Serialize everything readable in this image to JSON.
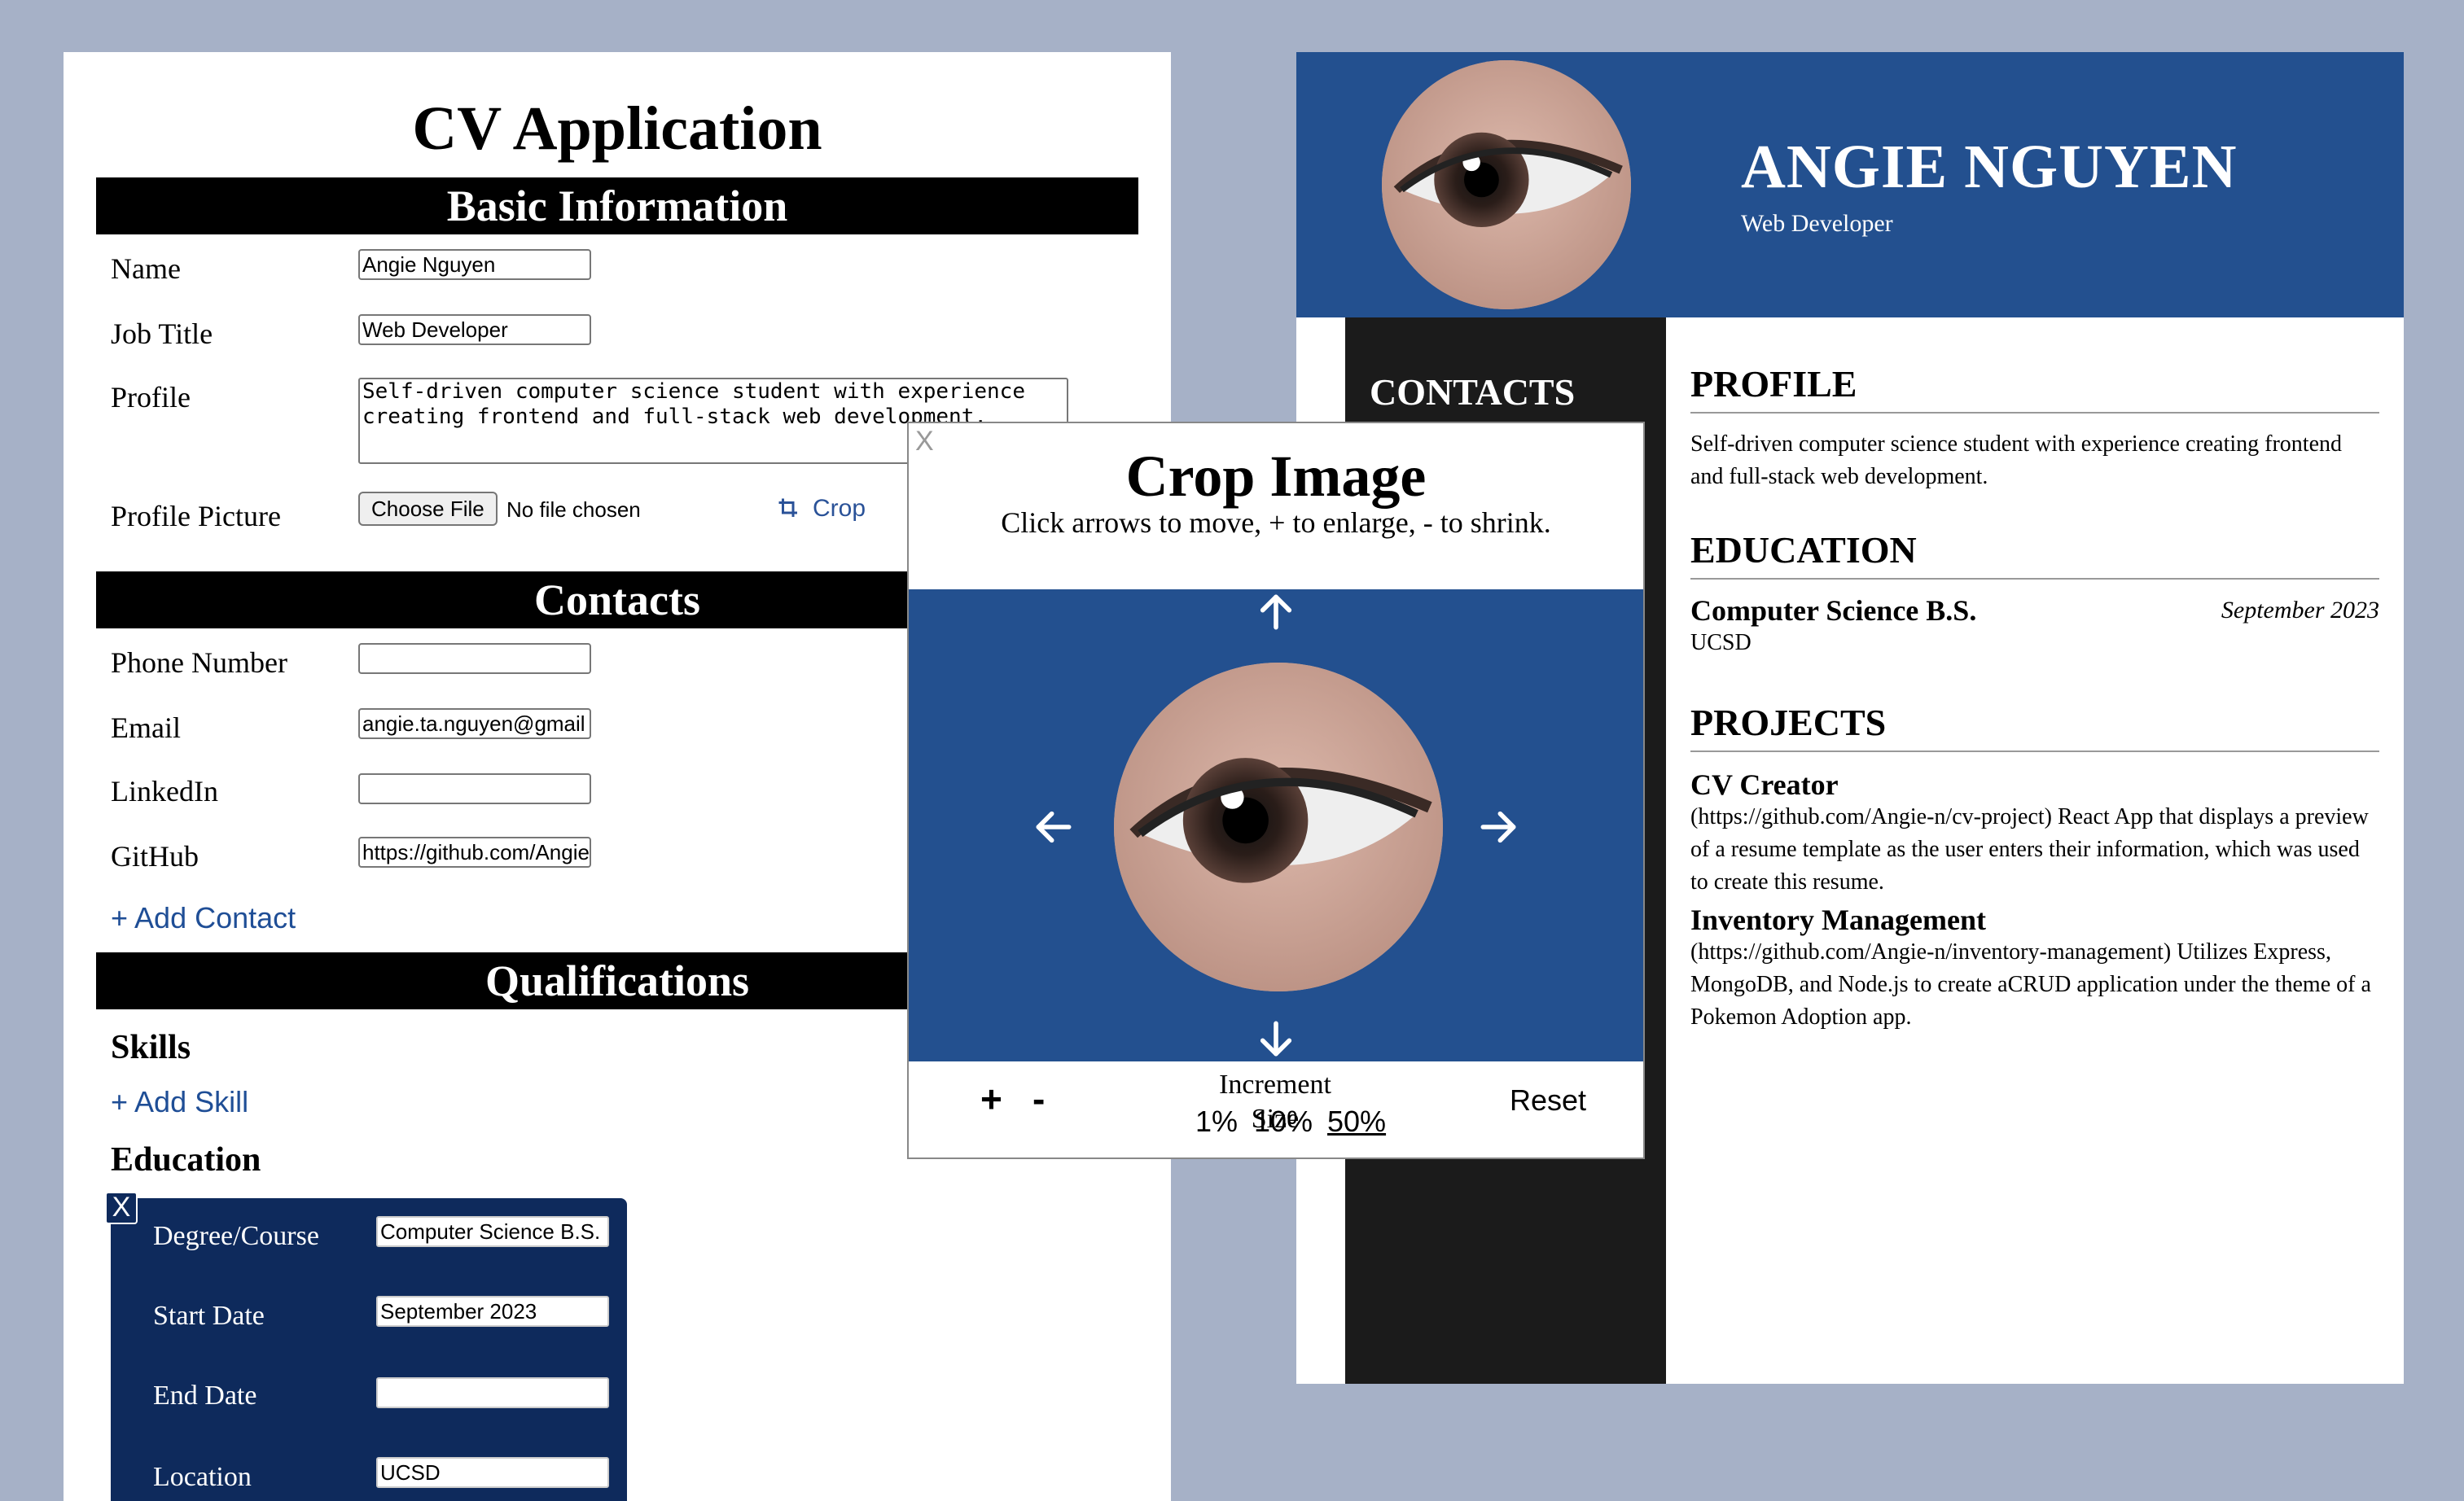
{
  "form": {
    "title": "CV Application",
    "sections": {
      "basic": "Basic Information",
      "contacts": "Contacts",
      "qualifications": "Qualifications"
    },
    "basic": {
      "name_label": "Name",
      "name_value": "Angie Nguyen",
      "job_label": "Job Title",
      "job_value": "Web Developer",
      "profile_label": "Profile",
      "profile_value": "Self-driven computer science student with experience creating frontend and full-stack web development.",
      "picture_label": "Profile Picture",
      "file_button": "Choose File",
      "file_status": "No file chosen",
      "crop_label": "Crop"
    },
    "contacts": {
      "phone_label": "Phone Number",
      "phone_value": "",
      "email_label": "Email",
      "email_value": "angie.ta.nguyen@gmail",
      "linkedin_label": "LinkedIn",
      "linkedin_value": "",
      "github_label": "GitHub",
      "github_value": "https://github.com/Angie",
      "add_contact": "+ Add Contact"
    },
    "qualifications": {
      "skills_heading": "Skills",
      "add_skill": "+ Add Skill",
      "education_heading": "Education",
      "education_entry": {
        "close": "X",
        "degree_label": "Degree/Course",
        "degree_value": "Computer Science B.S.",
        "start_label": "Start Date",
        "start_value": "September 2023",
        "end_label": "End Date",
        "end_value": "",
        "location_label": "Location",
        "location_value": "UCSD"
      }
    }
  },
  "resume": {
    "name": "ANGIE NGUYEN",
    "job_title": "Web Developer",
    "sidebar_heading": "CONTACTS",
    "profile_heading": "PROFILE",
    "profile_text": "Self-driven computer science student with experience creating frontend and full-stack web development.",
    "education_heading": "EDUCATION",
    "education": {
      "degree": "Computer Science B.S.",
      "date": "September 2023",
      "school": "UCSD"
    },
    "projects_heading": "PROJECTS",
    "projects": [
      {
        "title": "CV Creator",
        "description": "(https://github.com/Angie-n/cv-project) React App that displays a preview of a resume template as the user enters their information, which was used to create this resume."
      },
      {
        "title": "Inventory Management",
        "description": "(https://github.com/Angie-n/inventory-management) Utilizes Express, MongoDB, and Node.js to create aCRUD application under the theme of a Pokemon Adoption app."
      }
    ]
  },
  "crop_modal": {
    "close": "X",
    "title": "Crop Image",
    "instructions": "Click arrows to move, + to enlarge, - to shrink.",
    "enlarge": "+",
    "shrink": "-",
    "increment_label": "Increment Size",
    "increments": [
      "1%",
      "10%",
      "50%"
    ],
    "selected_increment": "50%",
    "reset": "Reset"
  },
  "colors": {
    "page_bg": "#a6b1c7",
    "resume_blue": "#23508f",
    "sidebar_dark": "#1b1b1b",
    "education_card": "#0e2a5c",
    "link_blue": "#1f4e96"
  },
  "icons": [
    "crop-icon",
    "arrow-up-icon",
    "arrow-down-icon",
    "arrow-left-icon",
    "arrow-right-icon",
    "close-icon",
    "eye-photo"
  ]
}
